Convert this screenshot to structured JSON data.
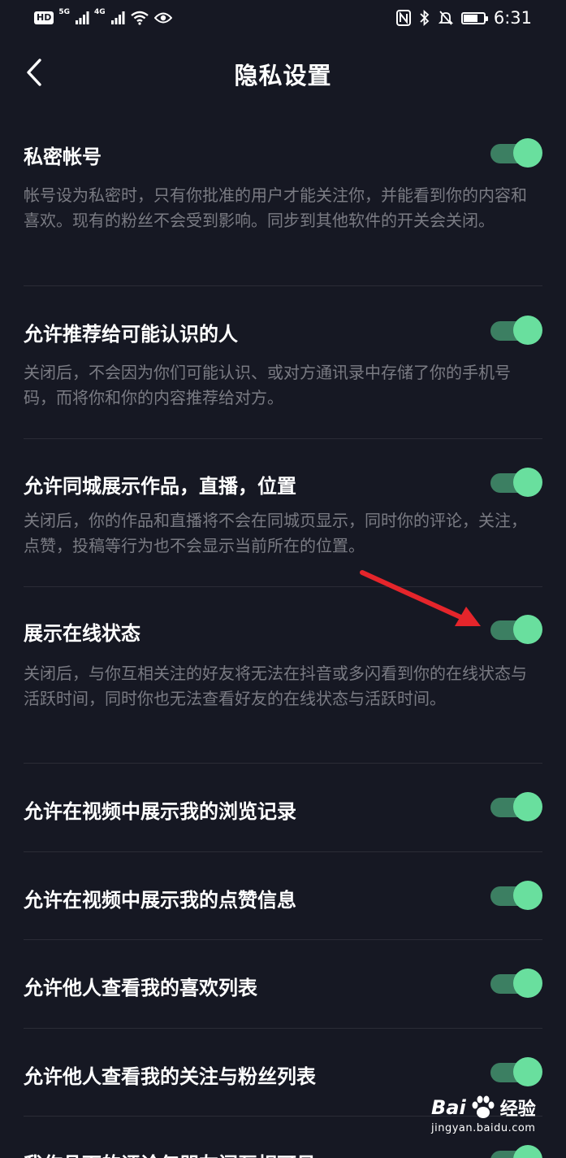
{
  "status_bar": {
    "hd_badge": "HD",
    "net1": "5G",
    "net2": "4G",
    "time": "6:31",
    "battery_level": 0.72
  },
  "nav": {
    "title": "隐私设置"
  },
  "settings": [
    {
      "title": "私密帐号",
      "desc": "帐号设为私密时，只有你批准的用户才能关注你，并能看到你的内容和喜欢。现有的粉丝不会受到影响。同步到其他软件的开关会关闭。",
      "enabled": true
    },
    {
      "title": "允许推荐给可能认识的人",
      "desc": "关闭后，不会因为你们可能认识、或对方通讯录中存储了你的手机号码，而将你和你的内容推荐给对方。",
      "enabled": true
    },
    {
      "title": "允许同城展示作品，直播，位置",
      "desc": "关闭后，你的作品和直播将不会在同城页显示，同时你的评论，关注，点赞，投稿等行为也不会显示当前所在的位置。",
      "enabled": true
    },
    {
      "title": "展示在线状态",
      "desc": "关闭后，与你互相关注的好友将无法在抖音或多闪看到你的在线状态与活跃时间，同时你也无法查看好友的在线状态与活跃时间。",
      "enabled": true
    },
    {
      "title": "允许在视频中展示我的浏览记录",
      "enabled": true
    },
    {
      "title": "允许在视频中展示我的点赞信息",
      "enabled": true
    },
    {
      "title": "允许他人查看我的喜欢列表",
      "enabled": true
    },
    {
      "title": "允许他人查看我的关注与粉丝列表",
      "enabled": true
    },
    {
      "title": "我作品下的评论仅朋友间互相可见",
      "enabled": true
    }
  ],
  "colors": {
    "background": "#161823",
    "toggle_track": "#3c7f62",
    "toggle_knob": "#69df9e",
    "arrow": "#e5252b"
  },
  "watermark": {
    "brand": "Bai",
    "brand_suffix": "经验",
    "domain": "jingyan.baidu.com"
  }
}
